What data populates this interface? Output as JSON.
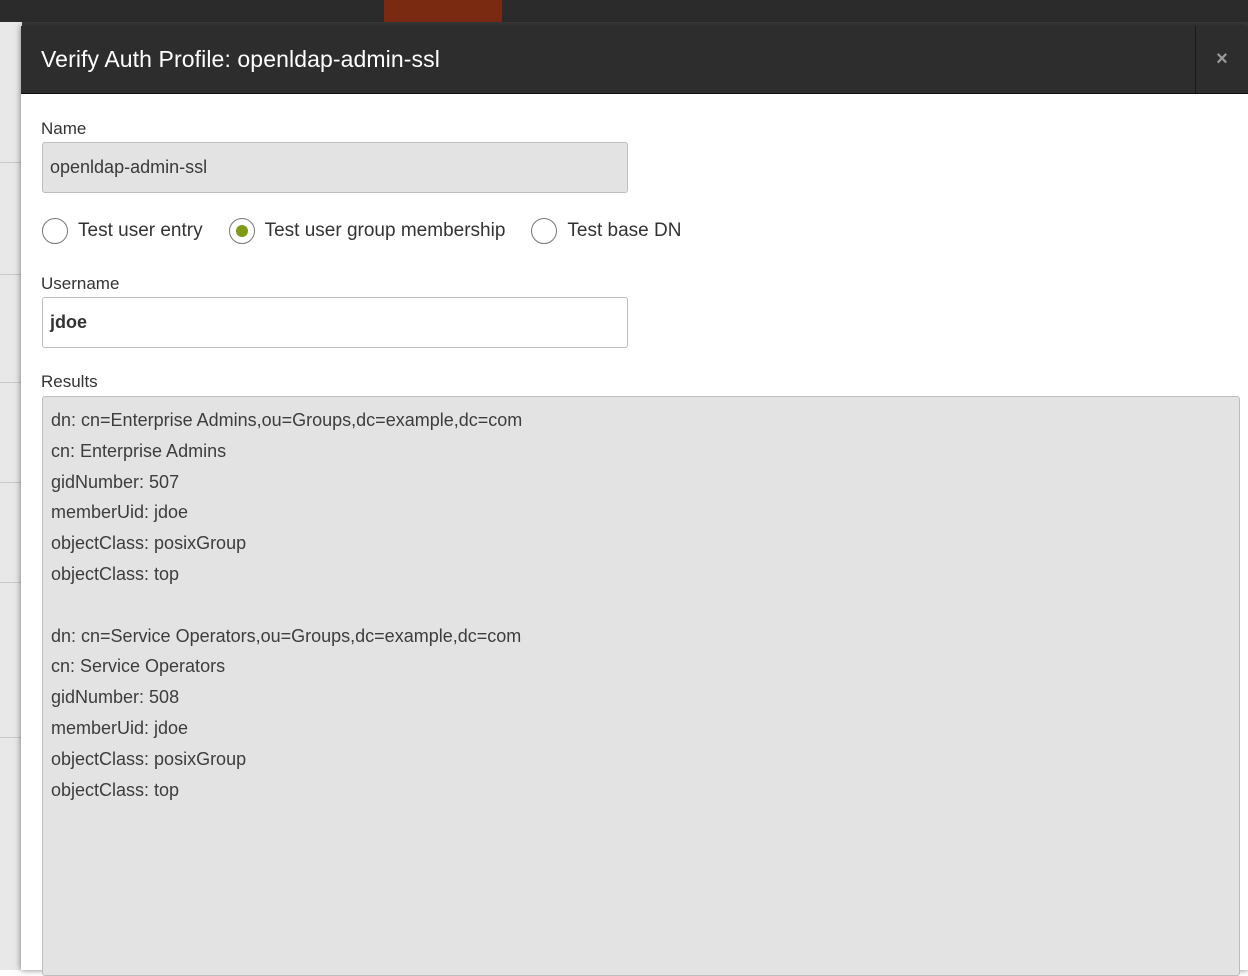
{
  "dialog": {
    "title": "Verify Auth Profile: openldap-admin-ssl",
    "close_label": "×"
  },
  "name_field": {
    "label": "Name",
    "value": "openldap-admin-ssl"
  },
  "test_options": [
    {
      "label": "Test user entry",
      "checked": false
    },
    {
      "label": "Test user group membership",
      "checked": true
    },
    {
      "label": "Test base DN",
      "checked": false
    }
  ],
  "username_field": {
    "label": "Username",
    "value": "jdoe"
  },
  "results": {
    "label": "Results",
    "lines": [
      "dn: cn=Enterprise Admins,ou=Groups,dc=example,dc=com",
      "cn: Enterprise Admins",
      "gidNumber: 507",
      "memberUid: jdoe",
      "objectClass: posixGroup",
      "objectClass: top",
      "",
      "dn: cn=Service Operators,ou=Groups,dc=example,dc=com",
      "cn: Service Operators",
      "gidNumber: 508",
      "memberUid: jdoe",
      "objectClass: posixGroup",
      "objectClass: top"
    ]
  },
  "colors": {
    "header_bg": "#2d2d2d",
    "radio_checked": "#7f9b15",
    "readonly_bg": "#e3e3e3"
  },
  "icons": {
    "close": "close-icon",
    "radio": "radio-icon"
  }
}
